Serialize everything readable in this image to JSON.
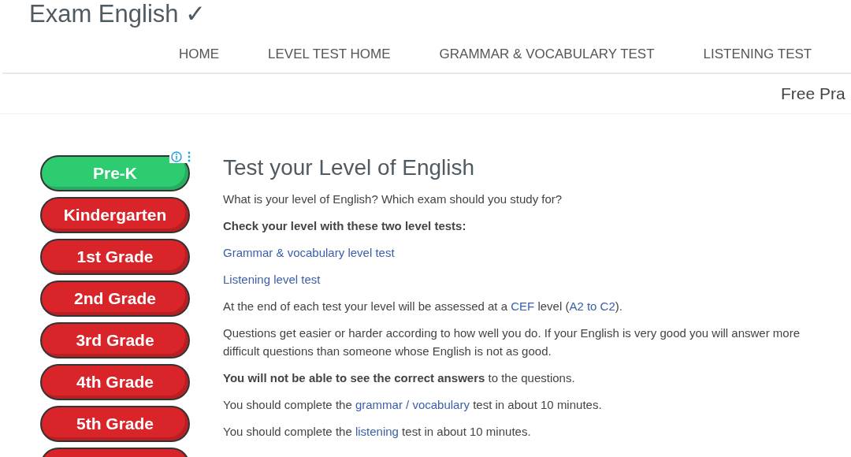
{
  "site_title": "Exam English ✓",
  "nav": [
    {
      "label": "HOME"
    },
    {
      "label": "LEVEL TEST HOME"
    },
    {
      "label": "GRAMMAR & VOCABULARY TEST"
    },
    {
      "label": "LISTENING TEST"
    }
  ],
  "subnav": {
    "label": "Free Pra"
  },
  "ad_buttons": [
    {
      "label": "Pre-K",
      "color": "#2ecc71"
    },
    {
      "label": "Kindergarten",
      "color": "#d9252a"
    },
    {
      "label": "1st Grade",
      "color": "#d9252a"
    },
    {
      "label": "2nd Grade",
      "color": "#d9252a"
    },
    {
      "label": "3rd Grade",
      "color": "#d9252a"
    },
    {
      "label": "4th Grade",
      "color": "#d9252a"
    },
    {
      "label": "5th Grade",
      "color": "#d9252a"
    },
    {
      "color": "#d9252a"
    }
  ],
  "content": {
    "heading": "Test your Level of English",
    "paragraphs": [
      [
        {
          "kind": "text",
          "text": "What is your level of English? Which exam should you study for?"
        }
      ],
      [
        {
          "kind": "text",
          "text": "**Check your level with these two level tests:**"
        }
      ],
      [
        {
          "kind": "link",
          "text": "Grammar & vocabulary level test"
        }
      ],
      [
        {
          "kind": "link",
          "text": "Listening level test"
        }
      ],
      [
        {
          "kind": "text",
          "text": "At the end of each test your level will be assessed at a "
        },
        {
          "kind": "link",
          "text": "CEF"
        },
        {
          "kind": "text",
          "text": " level ("
        },
        {
          "kind": "link",
          "text": "A2 to C2"
        },
        {
          "kind": "text",
          "text": ")."
        }
      ],
      [
        {
          "kind": "text",
          "text": "Questions get easier or harder according to how well you do. If your English is very good you will answer more difficult questions than someone whose English is not as good."
        }
      ],
      [
        {
          "kind": "text",
          "text": "**You will not be able to see the correct answers** to the questions."
        }
      ],
      [
        {
          "kind": "text",
          "text": "You should complete the "
        },
        {
          "kind": "link",
          "text": "grammar / vocabulary"
        },
        {
          "kind": "text",
          "text": " test in about 10 minutes."
        }
      ],
      [
        {
          "kind": "text",
          "text": "You should complete the "
        },
        {
          "kind": "link",
          "text": "listening"
        },
        {
          "kind": "text",
          "text": " test in about 10 minutes."
        }
      ]
    ]
  }
}
